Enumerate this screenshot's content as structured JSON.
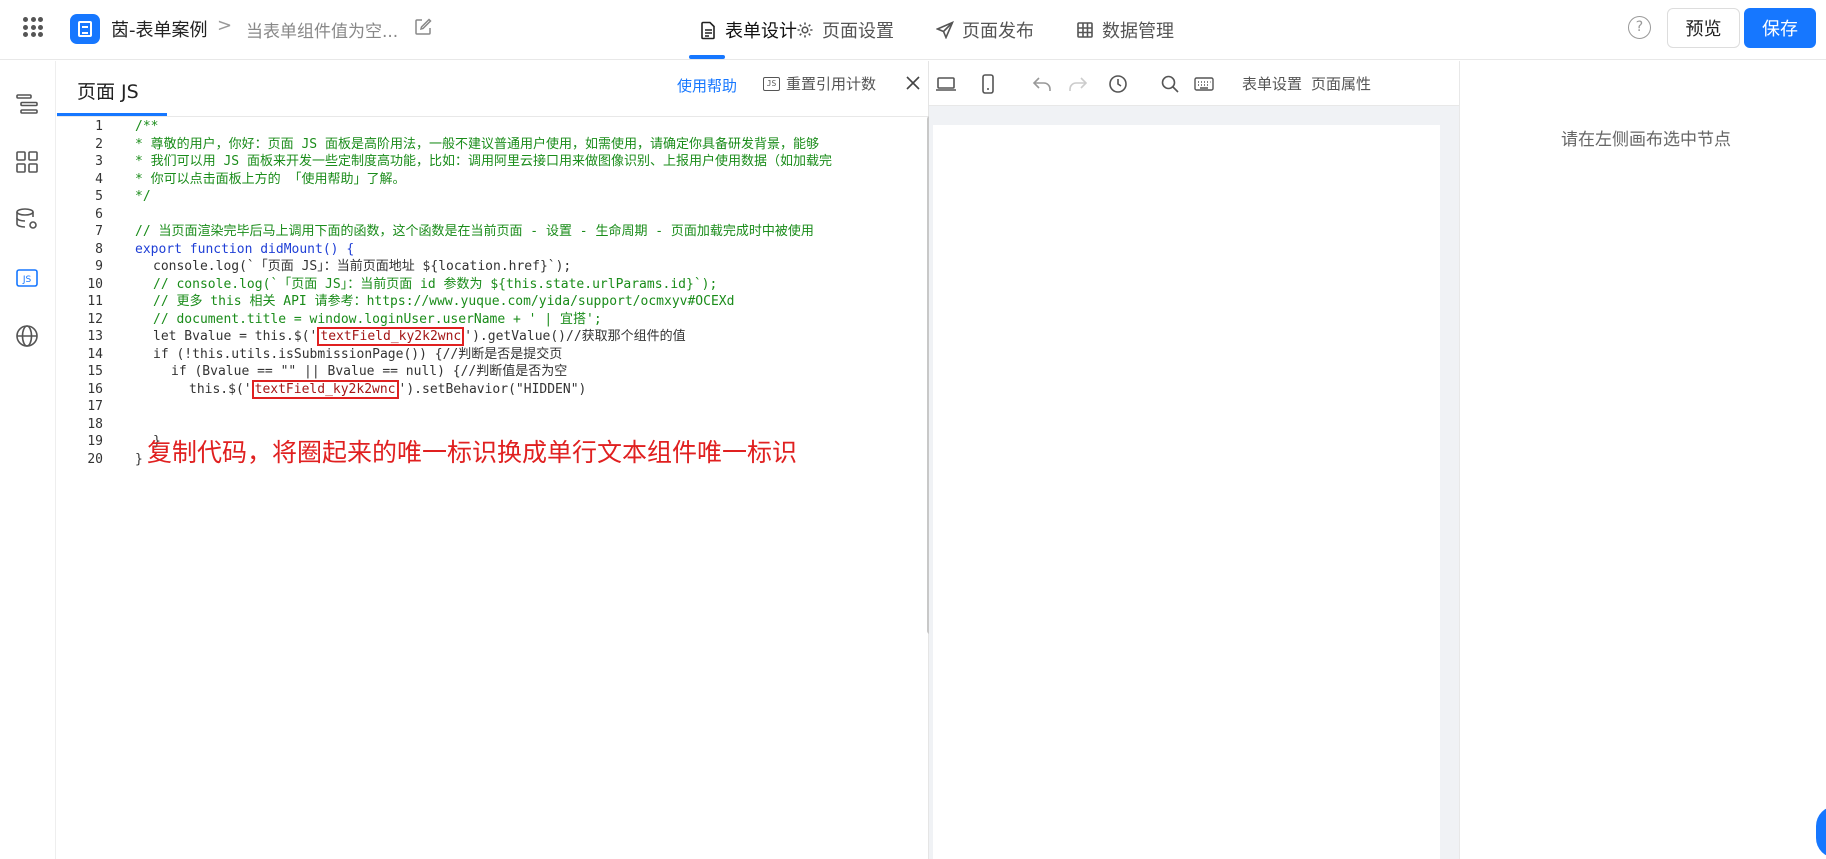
{
  "header": {
    "app_name": "茵-表单案例",
    "breadcrumb_separator": ">",
    "page_name": "当表单组件值为空...",
    "nav": [
      {
        "label": "表单设计",
        "icon": "document-icon",
        "active": true
      },
      {
        "label": "页面设置",
        "icon": "gear-icon",
        "active": false
      },
      {
        "label": "页面发布",
        "icon": "send-icon",
        "active": false
      },
      {
        "label": "数据管理",
        "icon": "table-icon",
        "active": false
      }
    ],
    "help_symbol": "?",
    "preview_label": "预览",
    "save_label": "保存"
  },
  "js_panel": {
    "title": "页面 JS",
    "help_label": "使用帮助",
    "js_badge": "JS",
    "reset_label": "重置引用计数",
    "annotation": "复制代码，将圈起来的唯一标识换成单行文本组件唯一标识",
    "highlight_id": "textField_ky2k2wnc"
  },
  "code_lines": [
    {
      "n": "1",
      "text": "/**"
    },
    {
      "n": "2",
      "text": "* 尊敬的用户，你好：页面 JS 面板是高阶用法，一般不建议普通用户使用，如需使用，请确定你具备研发背景，能够"
    },
    {
      "n": "3",
      "text": "* 我们可以用 JS 面板来开发一些定制度高功能，比如：调用阿里云接口用来做图像识别、上报用户使用数据（如加载完"
    },
    {
      "n": "4",
      "text": "* 你可以点击面板上方的 「使用帮助」了解。"
    },
    {
      "n": "5",
      "text": "*/"
    },
    {
      "n": "6",
      "text": ""
    },
    {
      "n": "7",
      "text": "// 当页面渲染完毕后马上调用下面的函数，这个函数是在当前页面 - 设置 - 生命周期 - 页面加载完成时中被使用"
    },
    {
      "n": "8",
      "text": "export function didMount() {"
    },
    {
      "n": "9",
      "text": "console.log(`「页面 JS」：当前页面地址 ${location.href}`);"
    },
    {
      "n": "10",
      "text": "// console.log(`「页面 JS」：当前页面 id 参数为 ${this.state.urlParams.id}`);"
    },
    {
      "n": "11",
      "text": "// 更多 this 相关 API 请参考：https://www.yuque.com/yida/support/ocmxyv#OCEXd"
    },
    {
      "n": "12",
      "text": "// document.title = window.loginUser.userName + ' | 宜搭';"
    },
    {
      "n": "13",
      "text": "let Bvalue = this.$('textField_ky2k2wnc').getValue()//获取那个组件的值"
    },
    {
      "n": "14",
      "text": "if (!this.utils.isSubmissionPage()) {//判断是否是提交页"
    },
    {
      "n": "15",
      "text": "if (Bvalue == \"\" || Bvalue == null) {//判断值是否为空"
    },
    {
      "n": "16",
      "text": "this.$('textField_ky2k2wnc').setBehavior(\"HIDDEN\")"
    },
    {
      "n": "17",
      "text": ""
    },
    {
      "n": "18",
      "text": ""
    },
    {
      "n": "19",
      "text": "}"
    },
    {
      "n": "20",
      "text": "}"
    }
  ],
  "toolbar": {
    "form_settings_label": "表单设置",
    "page_props_label": "页面属性"
  },
  "right_panel": {
    "hint": "请在左侧画布选中节点"
  },
  "colors": {
    "accent": "#1677ff",
    "annotation_red": "#e02020",
    "comment_green": "#1a8c1a",
    "keyword_blue": "#1f3fd6"
  }
}
